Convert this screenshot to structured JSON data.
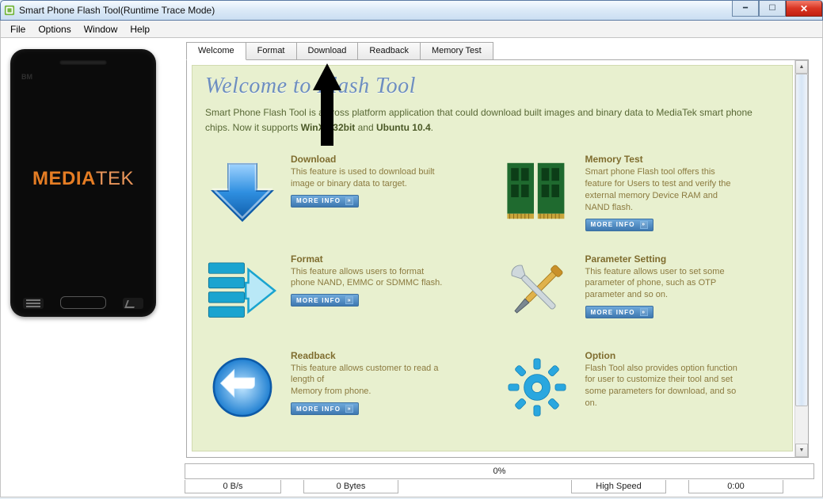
{
  "window": {
    "title": "Smart Phone Flash Tool(Runtime Trace Mode)"
  },
  "menu": {
    "file": "File",
    "options": "Options",
    "window": "Window",
    "help": "Help"
  },
  "tabs": {
    "welcome": "Welcome",
    "format": "Format",
    "download": "Download",
    "readback": "Readback",
    "memtest": "Memory Test"
  },
  "phone": {
    "bm": "BM",
    "brand": "MEDIATEK",
    "brand_prefix": "MEDIA",
    "brand_suffix": "TEK"
  },
  "welcome": {
    "title": "Welcome to Flash Tool",
    "intro_pre": "Smart Phone Flash Tool is a cross platform application that could download built images and binary data to MediaTek smart phone chips. Now it supports ",
    "intro_b1": "WinXp 32bit",
    "intro_mid": " and ",
    "intro_b2": "Ubuntu 10.4",
    "intro_post": ".",
    "more_label": "MORE INFO",
    "features": {
      "download": {
        "title": "Download",
        "desc": "This feature is used to download built image or binary data to target."
      },
      "memtest": {
        "title": "Memory Test",
        "desc": "Smart phone Flash tool offers this feature for Users to test and verify the external memory Device RAM and NAND flash."
      },
      "format": {
        "title": "Format",
        "desc": "This feature allows users to format phone NAND, EMMC or SDMMC flash."
      },
      "param": {
        "title": "Parameter Setting",
        "desc": "This feature allows user to set some parameter of phone, such as OTP parameter and so on."
      },
      "readback": {
        "title": "Readback",
        "desc": "This feature allows customer to read a length of\nMemory from phone."
      },
      "option": {
        "title": "Option",
        "desc": "Flash Tool also provides option function for user to customize their tool and set some parameters for download, and so on."
      }
    }
  },
  "status": {
    "progress": "0%",
    "cells": {
      "rate": "0 B/s",
      "bytes": "0 Bytes",
      "speed": "High Speed",
      "time": "0:00"
    }
  }
}
